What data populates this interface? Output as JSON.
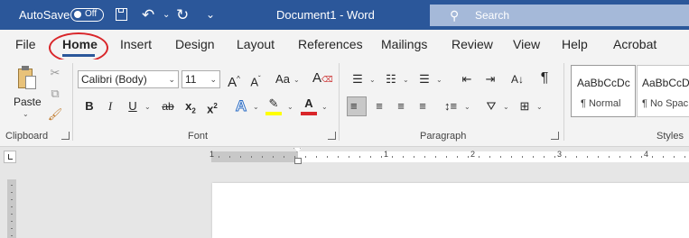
{
  "titlebar": {
    "autosave_label": "AutoSave",
    "autosave_state": "Off",
    "document_title": "Document1 - Word",
    "search_placeholder": "Search",
    "bg_color": "#2b579a"
  },
  "tabs": [
    {
      "label": "File"
    },
    {
      "label": "Home",
      "active": true
    },
    {
      "label": "Insert"
    },
    {
      "label": "Design"
    },
    {
      "label": "Layout"
    },
    {
      "label": "References"
    },
    {
      "label": "Mailings"
    },
    {
      "label": "Review"
    },
    {
      "label": "View"
    },
    {
      "label": "Help"
    },
    {
      "label": "Acrobat"
    }
  ],
  "annotation": {
    "circle_color": "#d9262a"
  },
  "ribbon": {
    "clipboard": {
      "paste_label": "Paste",
      "group_label": "Clipboard"
    },
    "font": {
      "font_name": "Calibri (Body)",
      "font_size": "11",
      "grow_label": "A",
      "shrink_label": "A",
      "case_label": "Aa",
      "bold": "B",
      "italic": "I",
      "underline": "U",
      "strike": "ab",
      "subscript": "x",
      "superscript": "x",
      "effects": "A",
      "highlight_color": "#ffff00",
      "font_color": "#d9262a",
      "group_label": "Font"
    },
    "paragraph": {
      "group_label": "Paragraph",
      "pilcrow": "¶"
    },
    "styles": {
      "group_label": "Styles",
      "items": [
        {
          "sample": "AaBbCcDc",
          "name": "¶ Normal"
        },
        {
          "sample": "AaBbCcDc",
          "name": "¶ No Spac"
        }
      ]
    }
  },
  "ruler": {
    "numbers": [
      "1",
      "1",
      "2",
      "3",
      "4"
    ]
  }
}
